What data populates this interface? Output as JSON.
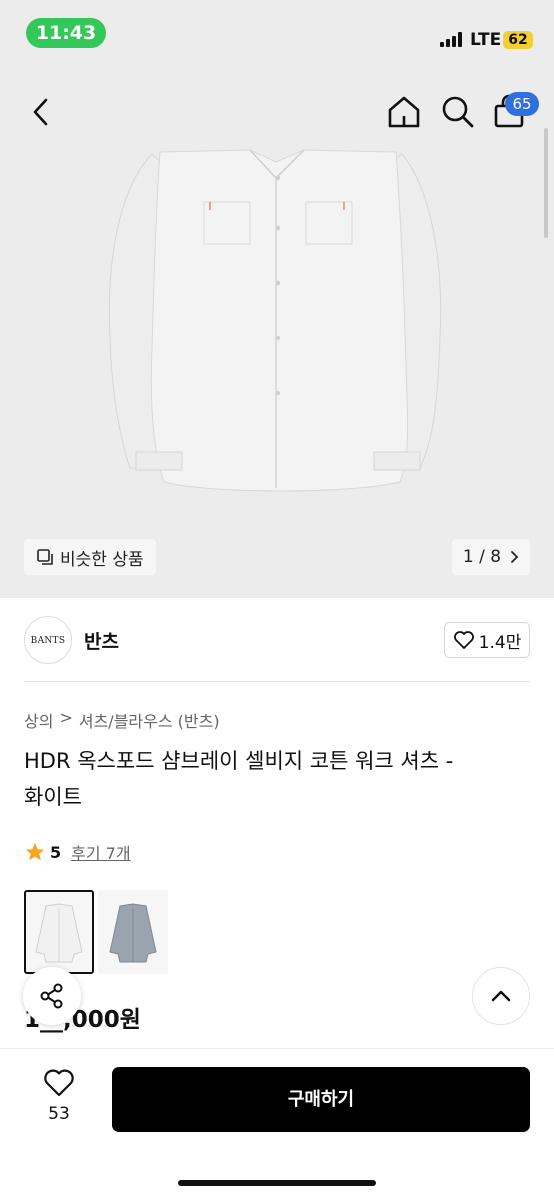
{
  "status_bar": {
    "time": "11:43",
    "network": "LTE",
    "battery": "62"
  },
  "header": {
    "cart_count": "65",
    "icons": [
      "back-icon",
      "home-icon",
      "search-icon",
      "shopping-bag-icon"
    ]
  },
  "gallery": {
    "similar_label": "비슷한 상품",
    "page_counter": "1 / 8",
    "shirt_color": "#f1f1f1"
  },
  "brand": {
    "logo_text": "BANTS",
    "name": "반츠",
    "likes": "1.4만"
  },
  "product": {
    "breadcrumb": [
      "상의",
      "셔츠/블라우스 (반츠)"
    ],
    "title_line1": "HDR 옥스포드 샴브레이 셀비지 코튼 워크 셔츠 -",
    "title_line2": "화이트",
    "rating": "5",
    "reviews": "후기 7개",
    "price": "1__,000원",
    "star_color": "#f5a623"
  },
  "options": {
    "thumb_colors": [
      "#f1f1f1",
      "#9aa4ae"
    ]
  },
  "footer": {
    "wish_count": "53",
    "buy_label": "구매하기"
  }
}
